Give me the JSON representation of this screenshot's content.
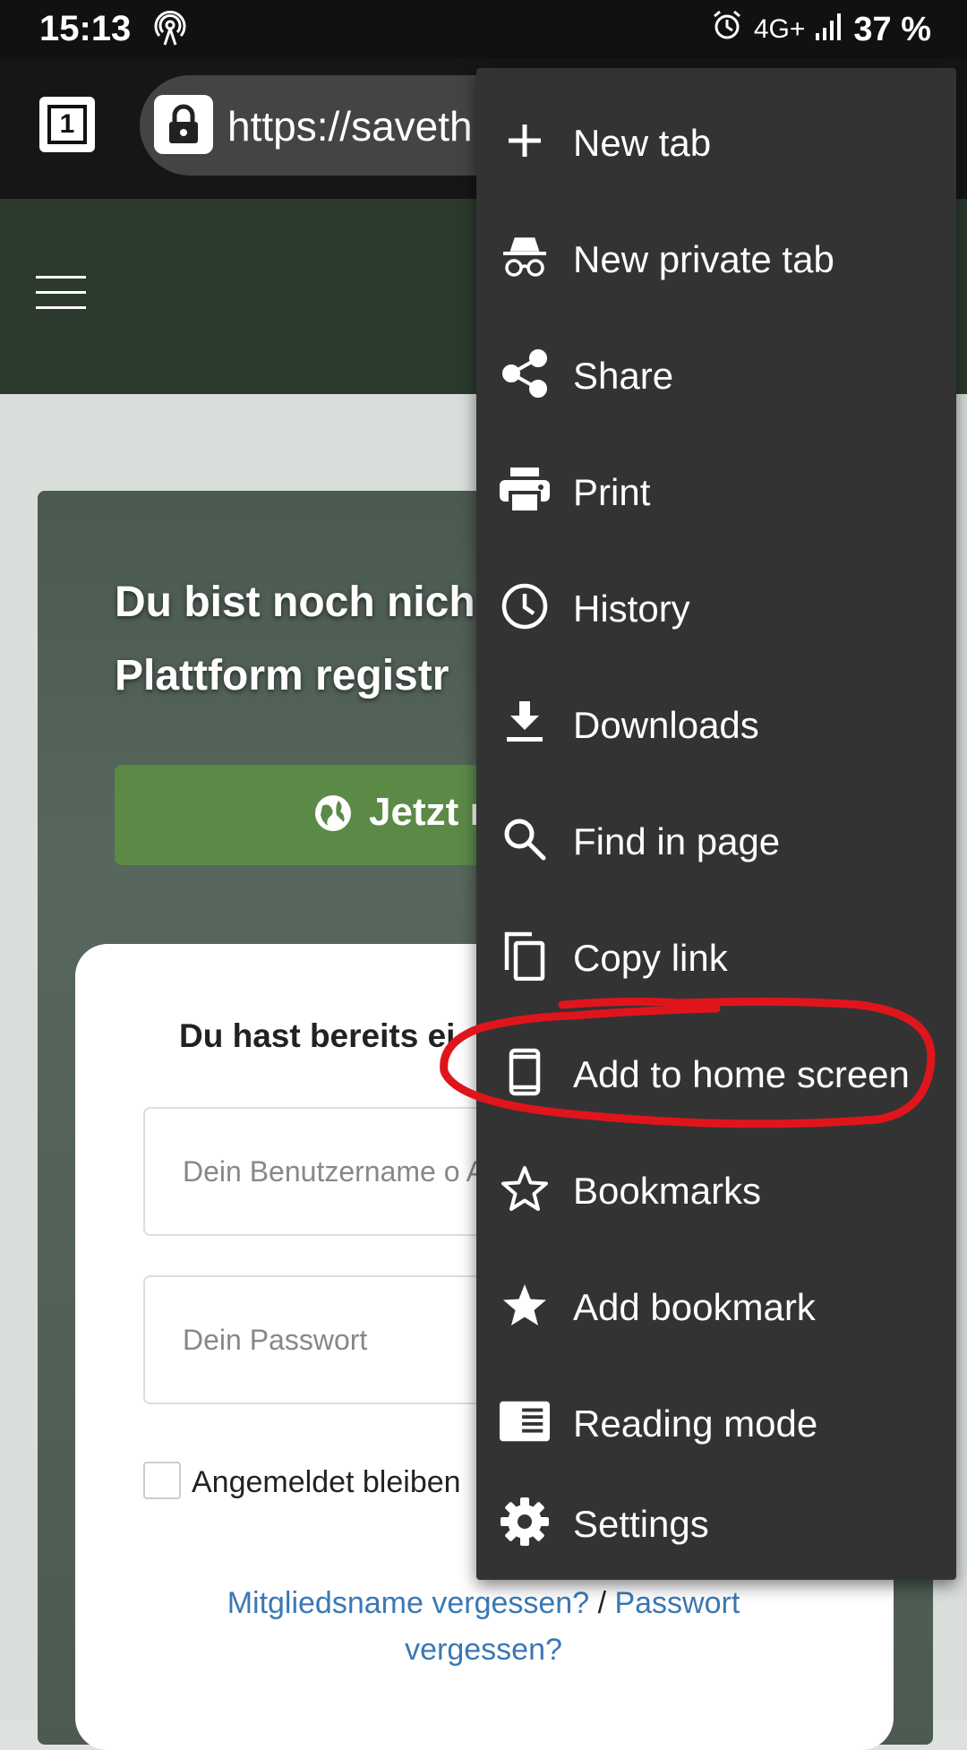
{
  "status_bar": {
    "time": "15:13",
    "network": "4G+",
    "battery": "37 %"
  },
  "browser": {
    "tab_count": "1",
    "url": "https://saveth"
  },
  "page": {
    "hero_title_line1": "Du bist noch nich",
    "hero_title_line2": "Plattform registr",
    "register_button": "Jetzt r",
    "login_title": "Du hast bereits ei",
    "username_placeholder": "Dein Benutzername o Adresse",
    "password_placeholder": "Dein Passwort",
    "remember_label": "Angemeldet bleiben",
    "forgot_username": "Mitgliedsname vergessen?",
    "forgot_separator": " / ",
    "forgot_password": "Passwort vergessen?"
  },
  "menu": {
    "items": [
      {
        "label": "New tab",
        "icon": "plus-icon"
      },
      {
        "label": "New private tab",
        "icon": "incognito-icon"
      },
      {
        "label": "Share",
        "icon": "share-icon"
      },
      {
        "label": "Print",
        "icon": "print-icon"
      },
      {
        "label": "History",
        "icon": "history-icon"
      },
      {
        "label": "Downloads",
        "icon": "download-icon"
      },
      {
        "label": "Find in page",
        "icon": "search-icon"
      },
      {
        "label": "Copy link",
        "icon": "copy-icon"
      },
      {
        "label": "Add to home screen",
        "icon": "phone-icon"
      },
      {
        "label": "Bookmarks",
        "icon": "star-outline-icon"
      },
      {
        "label": "Add bookmark",
        "icon": "star-filled-icon"
      },
      {
        "label": "Reading mode",
        "icon": "reading-mode-icon"
      },
      {
        "label": "Settings",
        "icon": "gear-icon"
      }
    ]
  },
  "colors": {
    "menu_bg": "#333333",
    "site_header": "#2b3a2c",
    "register_button": "#5b8a47",
    "link": "#3a78b5",
    "annotation": "#e0151b"
  }
}
